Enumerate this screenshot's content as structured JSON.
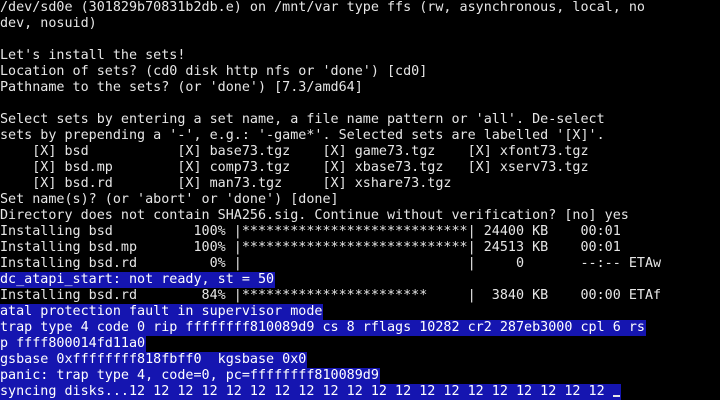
{
  "console": {
    "lines": [
      {
        "text": "/dev/sd0e (301829b70831b2db.e) on /mnt/var type ffs (rw, asynchronous, local, no",
        "highlight": false
      },
      {
        "text": "dev, nosuid)",
        "highlight": false
      },
      {
        "text": "",
        "highlight": false
      },
      {
        "text": "Let's install the sets!",
        "highlight": false
      },
      {
        "text": "Location of sets? (cd0 disk http nfs or 'done') [cd0]",
        "highlight": false
      },
      {
        "text": "Pathname to the sets? (or 'done') [7.3/amd64]",
        "highlight": false
      },
      {
        "text": "",
        "highlight": false
      },
      {
        "text": "Select sets by entering a set name, a file name pattern or 'all'. De-select",
        "highlight": false
      },
      {
        "text": "sets by prepending a '-', e.g.: '-game*'. Selected sets are labelled '[X]'.",
        "highlight": false
      },
      {
        "text": "    [X] bsd           [X] base73.tgz    [X] game73.tgz    [X] xfont73.tgz",
        "highlight": false
      },
      {
        "text": "    [X] bsd.mp        [X] comp73.tgz    [X] xbase73.tgz   [X] xserv73.tgz",
        "highlight": false
      },
      {
        "text": "    [X] bsd.rd        [X] man73.tgz     [X] xshare73.tgz",
        "highlight": false
      },
      {
        "text": "Set name(s)? (or 'abort' or 'done') [done]",
        "highlight": false
      },
      {
        "text": "Directory does not contain SHA256.sig. Continue without verification? [no] yes",
        "highlight": false
      },
      {
        "text": "Installing bsd          100% |****************************| 24400 KB    00:01",
        "highlight": false
      },
      {
        "text": "Installing bsd.mp       100% |****************************| 24513 KB    00:01",
        "highlight": false
      },
      {
        "text": "Installing bsd.rd         0% |                            |     0       --:-- ETAw",
        "highlight": false
      },
      {
        "text": "dc_atapi_start: not ready, st = 50",
        "highlight": true
      },
      {
        "text": "Installing bsd.rd        84% |***********************     |  3840 KB    00:00 ETAf",
        "highlight": false
      },
      {
        "text": "atal protection fault in supervisor mode",
        "highlight": true
      },
      {
        "text": "trap type 4 code 0 rip ffffffff810089d9 cs 8 rflags 10282 cr2 287eb3000 cpl 6 rs",
        "highlight": true
      },
      {
        "text": "p ffff800014fd11a0",
        "highlight": true
      },
      {
        "text": "gsbase 0xffffffff818fbff0  kgsbase 0x0",
        "highlight": true
      },
      {
        "text": "panic: trap type 4, code=0, pc=ffffffff810089d9",
        "highlight": true
      },
      {
        "text": "syncing disks...12 12 12 12 12 12 12 12 12 12 12 12 12 12 12 12 12 12 12 12 ",
        "highlight": true
      }
    ],
    "cursor": "_",
    "colors": {
      "background": "#000000",
      "foreground": "#e6e6e6",
      "highlight_background": "#1515b0",
      "highlight_foreground": "#ffffff"
    }
  }
}
